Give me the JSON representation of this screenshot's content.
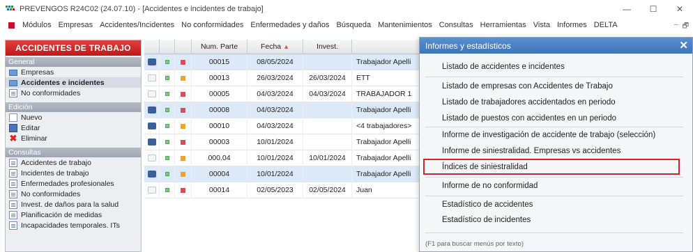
{
  "window": {
    "title": "PREVENGOS R24C02 (24.07.10) - [Accidentes e incidentes de trabajo]",
    "controls": [
      "—",
      "☐",
      "✕"
    ]
  },
  "menubar": {
    "items": [
      "Módulos",
      "Empresas",
      "Accidentes/Incidentes",
      "No conformidades",
      "Enfermedades y daños",
      "Búsqueda",
      "Mantenimientos",
      "Consultas",
      "Herramientas",
      "Vista",
      "Informes",
      "DELTA"
    ],
    "mdi_controls": [
      "–",
      "🗗"
    ]
  },
  "leftpanel": {
    "header": "ACCIDENTES DE TRABAJO",
    "general_label": "General",
    "general_items": [
      "Empresas",
      "Accidentes e incidentes",
      "No conformidades"
    ],
    "edicion_label": "Edición",
    "edicion_items": [
      "Nuevo",
      "Editar",
      "Eliminar"
    ],
    "consultas_label": "Consultas",
    "consultas_items": [
      "Accidentes de trabajo",
      "Incidentes de trabajo",
      "Enfermedades profesionales",
      "No conformidades",
      "Invest. de daños para la salud",
      "Planificación de medidas",
      "Incapacidades temporales. ITs"
    ]
  },
  "grid": {
    "columns": [
      "",
      "",
      "",
      "Num. Parte",
      "Fecha",
      "Invest.",
      ""
    ],
    "rows": [
      {
        "icon": "car",
        "color": "red",
        "num": "00015",
        "fecha": "08/05/2024",
        "invest": "",
        "trab": "Trabajador Apelli",
        "sel": true
      },
      {
        "icon": "arrow",
        "color": "orange",
        "num": "00013",
        "fecha": "26/03/2024",
        "invest": "26/03/2024",
        "trab": "ETT",
        "sel": false
      },
      {
        "icon": "arrow",
        "color": "red",
        "num": "00005",
        "fecha": "04/03/2024",
        "invest": "04/03/2024",
        "trab": "TRABAJADOR 1",
        "sel": false
      },
      {
        "icon": "car",
        "color": "red",
        "num": "00008",
        "fecha": "04/03/2024",
        "invest": "",
        "trab": "Trabajador Apelli",
        "sel": true
      },
      {
        "icon": "car",
        "color": "orange",
        "num": "00010",
        "fecha": "04/03/2024",
        "invest": "",
        "trab": "<4 trabajadores>",
        "sel": false
      },
      {
        "icon": "car",
        "color": "red",
        "num": "00003",
        "fecha": "10/01/2024",
        "invest": "",
        "trab": "Trabajador Apelli",
        "sel": false
      },
      {
        "icon": "arrow",
        "color": "orange",
        "num": "000.04",
        "fecha": "10/01/2024",
        "invest": "10/01/2024",
        "trab": "Trabajador Apelli",
        "sel": false
      },
      {
        "icon": "car",
        "color": "orange",
        "num": "00004",
        "fecha": "10/01/2024",
        "invest": "",
        "trab": "Trabajador Apelli",
        "sel": true
      },
      {
        "icon": "arrow",
        "color": "red",
        "num": "00014",
        "fecha": "02/05/2023",
        "invest": "02/05/2024",
        "trab": "Juan",
        "sel": false
      }
    ]
  },
  "popup": {
    "title": "Informes y estadísticos",
    "close": "✕",
    "items": [
      "Listado de accidentes e incidentes",
      "Listado de empresas con Accidentes de Trabajo",
      "Listado de trabajadores accidentados en periodo",
      "Listado de puestos con accidentes en un periodo",
      "Informe de investigación de accidente de trabajo (selección)",
      "Informe de siniestralidad. Empresas vs accidentes",
      "Índices de siniestralidad",
      "Informe de no conformidad",
      "Estadístico de accidentes",
      "Estadístico de incidentes"
    ],
    "footer": "(F1 para buscar menús por texto)"
  },
  "colors": {
    "accent_red": "#c8102e",
    "popup_blue": "#4a80c4",
    "highlight": "#d6222a"
  }
}
